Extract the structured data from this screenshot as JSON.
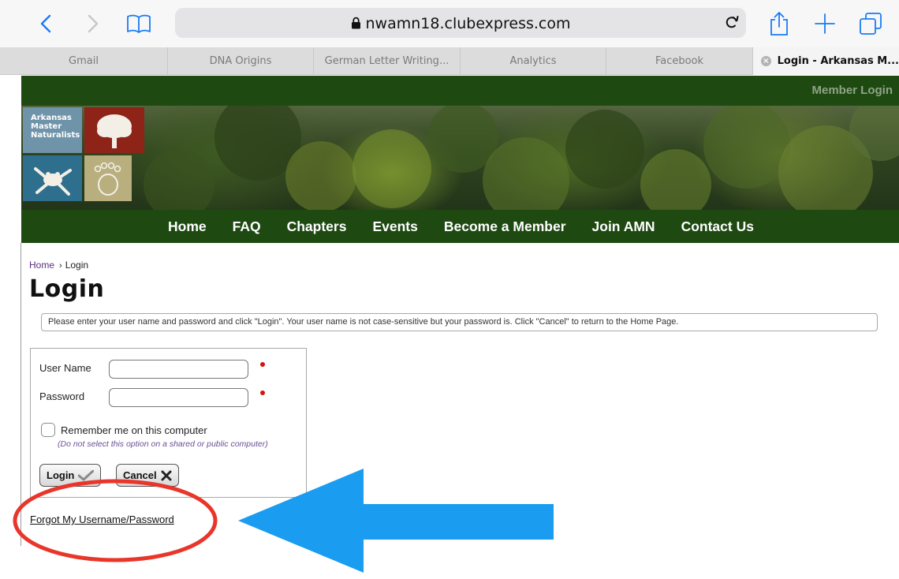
{
  "browser": {
    "url": "nwamn18.clubexpress.com",
    "tabs": [
      {
        "label": "Gmail",
        "active": false
      },
      {
        "label": "DNA Origins",
        "active": false
      },
      {
        "label": "German Letter Writing...",
        "active": false
      },
      {
        "label": "Analytics",
        "active": false
      },
      {
        "label": "Facebook",
        "active": false
      },
      {
        "label": "Login - Arkansas M...",
        "active": true
      }
    ]
  },
  "header": {
    "member_login": "Member Login",
    "logo_text": [
      "Arkansas",
      "Master",
      "Naturalists"
    ]
  },
  "nav": {
    "items": [
      "Home",
      "FAQ",
      "Chapters",
      "Events",
      "Become a Member",
      "Join AMN",
      "Contact Us"
    ]
  },
  "breadcrumb": {
    "home": "Home",
    "separator": "›",
    "current": "Login"
  },
  "page": {
    "title": "Login",
    "instructions": "Please enter your user name and password and click \"Login\". Your user name is not case-sensitive but your password is. Click \"Cancel\" to return to the Home Page."
  },
  "form": {
    "username_label": "User Name",
    "username_value": "",
    "password_label": "Password",
    "password_value": "",
    "remember_label": "Remember me on this computer",
    "remember_checked": false,
    "remember_note": "(Do not select this option on a shared or public computer)",
    "login_button": "Login",
    "cancel_button": "Cancel"
  },
  "forgot_link": "Forgot My Username/Password",
  "colors": {
    "site_green": "#1e4a12",
    "annotation_arrow": "#1a9cf0",
    "annotation_circle": "#e8362a",
    "required_dot": "#d81010"
  },
  "icons": {
    "back": "chevron-left-icon",
    "forward": "chevron-right-icon",
    "bookmarks": "book-icon",
    "lock": "lock-icon",
    "reload": "reload-icon",
    "share": "share-icon",
    "new_tab": "plus-icon",
    "tabs": "tabs-icon",
    "login_check": "checkmark-icon",
    "cancel_x": "x-icon"
  }
}
